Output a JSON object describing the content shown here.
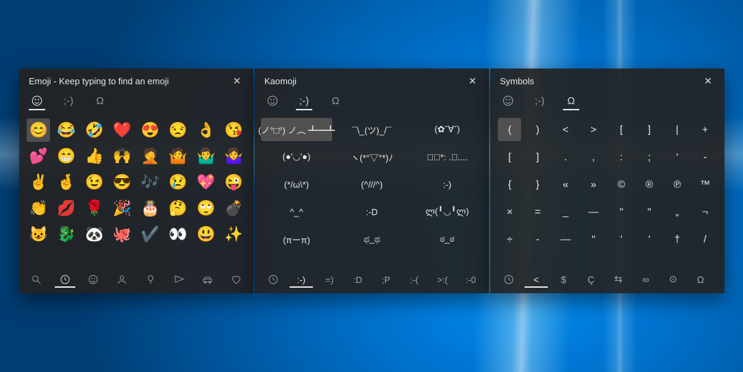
{
  "panels": {
    "emoji": {
      "title": "Emoji - Keep typing to find an emoji",
      "tabs_active": 0,
      "grid": [
        "😊",
        "😂",
        "🤣",
        "❤️",
        "😍",
        "😒",
        "👌",
        "😘",
        "💕",
        "😁",
        "👍",
        "🙌",
        "🤦",
        "🤷",
        "🤷‍♂️",
        "🤷‍♀️",
        "✌️",
        "🤞",
        "😉",
        "😎",
        "🎶",
        "😢",
        "💖",
        "😜",
        "👏",
        "💋",
        "🌹",
        "🎉",
        "🎂",
        "🤔",
        "🙄",
        "💣",
        "😺",
        "🐉",
        "🐼",
        "🐙",
        "✔️",
        "👀",
        "😃",
        "✨"
      ],
      "selected_index": 0,
      "categories_active": 1
    },
    "kaomoji": {
      "title": "Kaomoji",
      "tabs_active": 1,
      "grid": [
        "(ノ°□°) ノ︵ ┻━┻",
        "¯\\_(ツ)_/¯",
        "(✿ˇ∀ˇ)",
        "(●'◡'●)",
        "ヽ(*°▽°*)ﾉ",
        "✲ﾟ*: .｡....",
        "(*/ω\\*)",
        "(^///^)",
        ":-)",
        "^_^",
        ":-D",
        "ლ(╹◡╹ლ)",
        "(πーπ)",
        "ಥ_ಥ",
        "ಠ_ಠ"
      ],
      "selected_index": 0,
      "cats": [
        ":-)",
        "=)",
        ":D",
        ";P",
        ":-(",
        ">:(",
        ":-0"
      ],
      "cats_active": 1
    },
    "symbols": {
      "title": "Symbols",
      "tabs_active": 2,
      "grid": [
        "(",
        ")",
        "<",
        ">",
        "[",
        "]",
        "|",
        "+",
        "[",
        "]",
        ".",
        ",",
        ":",
        ";",
        "'",
        "-",
        "{",
        "}",
        "«",
        "»",
        "©",
        "®",
        "℗",
        "™",
        "×",
        "=",
        "_",
        "—",
        "\"",
        "\"",
        "„",
        "¬",
        "÷",
        "-",
        "—",
        "\"",
        "'",
        "'",
        "†",
        "/"
      ],
      "selected_index": 0,
      "cats": [
        "$",
        "Ç",
        "⇆",
        "∞",
        "⊙",
        "Ω"
      ],
      "cats_active": 1
    }
  }
}
